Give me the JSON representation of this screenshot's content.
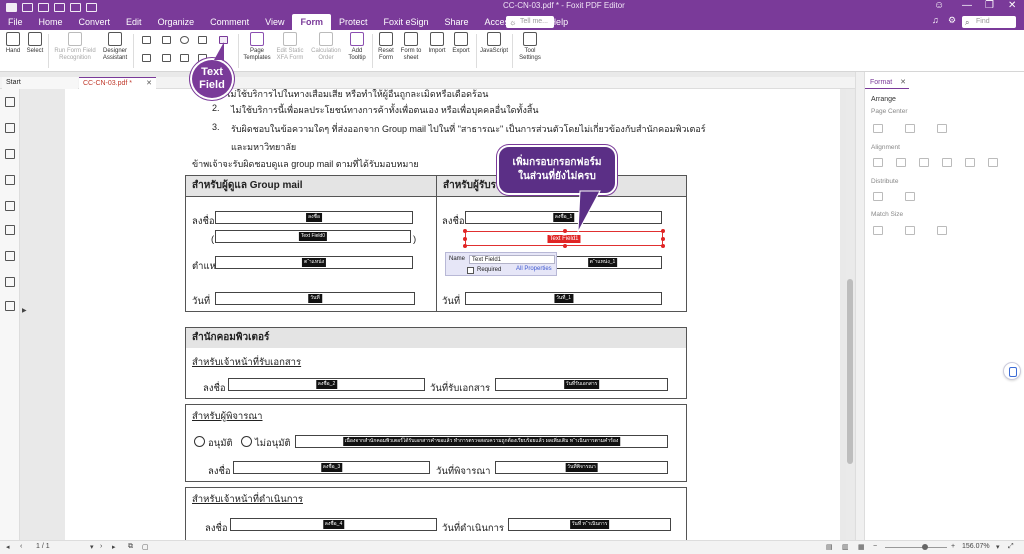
{
  "titlebar": {
    "document_title": "CC-CN-03.pdf * - Foxit PDF Editor",
    "tell_me": "Tell me...",
    "find": "Find"
  },
  "menu": [
    "File",
    "Home",
    "Convert",
    "Edit",
    "Organize",
    "Comment",
    "View",
    "Form",
    "Protect",
    "Foxit eSign",
    "Share",
    "Accessibility",
    "Help"
  ],
  "ribbon": {
    "hand": "Hand",
    "select": "Select",
    "run_form_field_recognition": "Run Form Field Recognition",
    "designer_assistant": "Designer Assistant",
    "page_templates": "Page Templates",
    "edit_static_xfa_form": "Edit Static XFA Form",
    "calculation_order": "Calculation Order",
    "add_tooltip": "Add Tooltip",
    "reset_form": "Reset Form",
    "form_to_sheet": "Form to sheet",
    "import": "Import",
    "export": "Export",
    "javascript": "JavaScript",
    "tool_settings": "Tool Settings"
  },
  "tabs": {
    "start": "Start",
    "doc": "CC-CN-03.pdf *"
  },
  "document": {
    "list_line1": "ไม่ใช้บริการไปในทางเสื่อมเสีย หรือทำให้ผู้อื่นถูกละเมิดหรือเดือดร้อน",
    "list_line2": "ไม่ใช้บริการนี้เพื่อผลประโยชน์ทางการค้าทั้งเพื่อตนเอง หรือเพื่อบุคคลอื่นใดทั้งสิ้น",
    "list_num3": "3.",
    "list_num2": "2.",
    "list_line3": "รับผิดชอบในข้อความใดๆ ที่ส่งออกจาก Group mail ไปในที่ \"สาธารณะ\" เป็นการส่วนตัวโดยไม่เกี่ยวข้องกับสำนักคอมพิวเตอร์",
    "list_line4": "และมหาวิทยาลัย",
    "accept_line": "ข้าพเจ้าจะรับผิดชอบดูแล group  mail ตามที่ได้รับมอบหมาย",
    "left_head": "สำหรับผู้ดูแล Group mail",
    "right_head": "สำหรับผู้รับรอ",
    "sign": "ลงชื่อ",
    "position": "ตำแหน่ง",
    "date": "วันที่",
    "open_paren": "(",
    "close_paren": ")",
    "fields": {
      "sign_left": "ลงชื่อ",
      "textfield0": "Text Field0",
      "position_left": "ต ำแหน่ง",
      "date_left": "วันที่",
      "sign_right": "ลงชื่อ_1",
      "position_right": "ต ำแหน่ง_1",
      "date_right": "วันที่_1",
      "sign_2": "ลงชื่อ_2",
      "received_date": "วันที่รับเอกสาร",
      "opinion": "เนื่องจากสำนักคอมพิวเตอร์ได้รับเอกสารคำขอแล้ว ทำการตรวจสอบความถูกต้องเรียบร้อยแล้ว ผลเพิ่มเติม ท ำเนินการตามคำร้อง",
      "sign_3": "ลงชื่อ_3",
      "consider_date": "วันที่พิจารณา",
      "sign_4": "ลงชื่อ_4",
      "process_date": "วันที่ ท ำเนินการ"
    },
    "office_head": "สำนักคอมพิวเตอร์",
    "for_receiver": "สำหรับเจ้าหน้าที่รับเอกสาร",
    "received_date_label": "วันที่รับเอกสาร",
    "for_considerer": "สำหรับผู้พิจารณา",
    "approve": "อนุมัติ",
    "disapprove": "ไม่อนุมัติ",
    "consider_date_label": "วันที่พิจารณา",
    "for_processor": "สำหรับเจ้าหน้าที่ดำเนินการ",
    "process_date_label": "วันที่ดำเนินการ"
  },
  "new_field": {
    "tag": "Text Field1",
    "popup_name_label": "Name",
    "popup_name_value": "Text Field1",
    "required": "Required",
    "all_properties": "All Properties"
  },
  "callouts": {
    "text_field": "Text Field",
    "add_field_line1": "เพิ่มกรอบกรอกฟอร์ม",
    "add_field_line2": "ในส่วนที่ยังไม่ครบ"
  },
  "right_panel": {
    "tab": "Format",
    "arrange": "Arrange",
    "page_center": "Page Center",
    "alignment": "Alignment",
    "distribute": "Distribute",
    "match_size": "Match Size"
  },
  "status": {
    "page": "1 / 1",
    "zoom": "156.07%"
  },
  "colors": {
    "brand": "#7a3a99",
    "callout": "#5b2f86",
    "selection": "#e02424"
  }
}
